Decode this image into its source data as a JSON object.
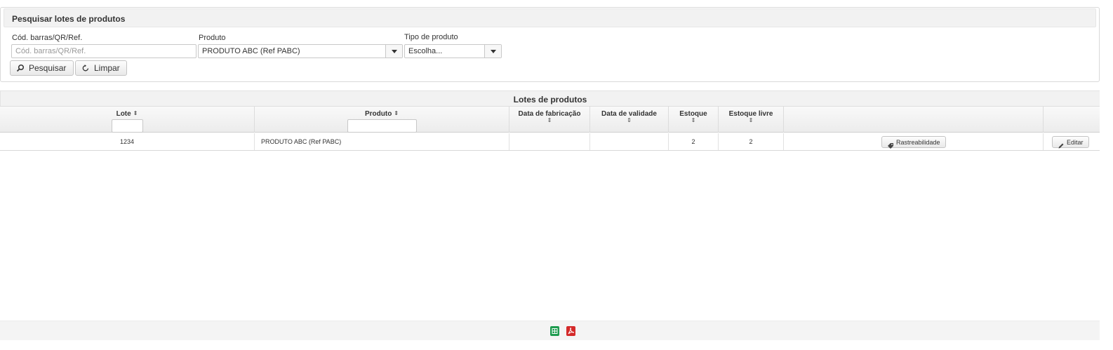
{
  "search": {
    "title": "Pesquisar lotes de produtos",
    "barcode": {
      "label": "Cód. barras/QR/Ref.",
      "value": "",
      "placeholder": "Cód. barras/QR/Ref."
    },
    "product": {
      "label": "Produto",
      "value": "PRODUTO ABC (Ref PABC)"
    },
    "product_type": {
      "label": "Tipo de produto",
      "value": "Escolha..."
    },
    "buttons": {
      "search": "Pesquisar",
      "clear": "Limpar"
    }
  },
  "results": {
    "title": "Lotes de produtos",
    "columns": {
      "lote": "Lote",
      "produto": "Produto",
      "fabricacao": "Data de fabricação",
      "validade": "Data de validade",
      "estoque": "Estoque",
      "estoque_livre": "Estoque livre"
    },
    "rows": [
      {
        "lote": "1234",
        "produto": "PRODUTO ABC (Ref PABC)",
        "fabricacao": "",
        "validade": "",
        "estoque": "2",
        "estoque_livre": "2",
        "trace_label": "Rastreabilidade",
        "edit_label": "Editar"
      }
    ]
  },
  "export": {
    "icons": [
      "spreadsheet-icon",
      "pdf-icon"
    ],
    "colors": {
      "spreadsheet": "#1e9b4f",
      "pdf": "#d42a2a"
    }
  }
}
